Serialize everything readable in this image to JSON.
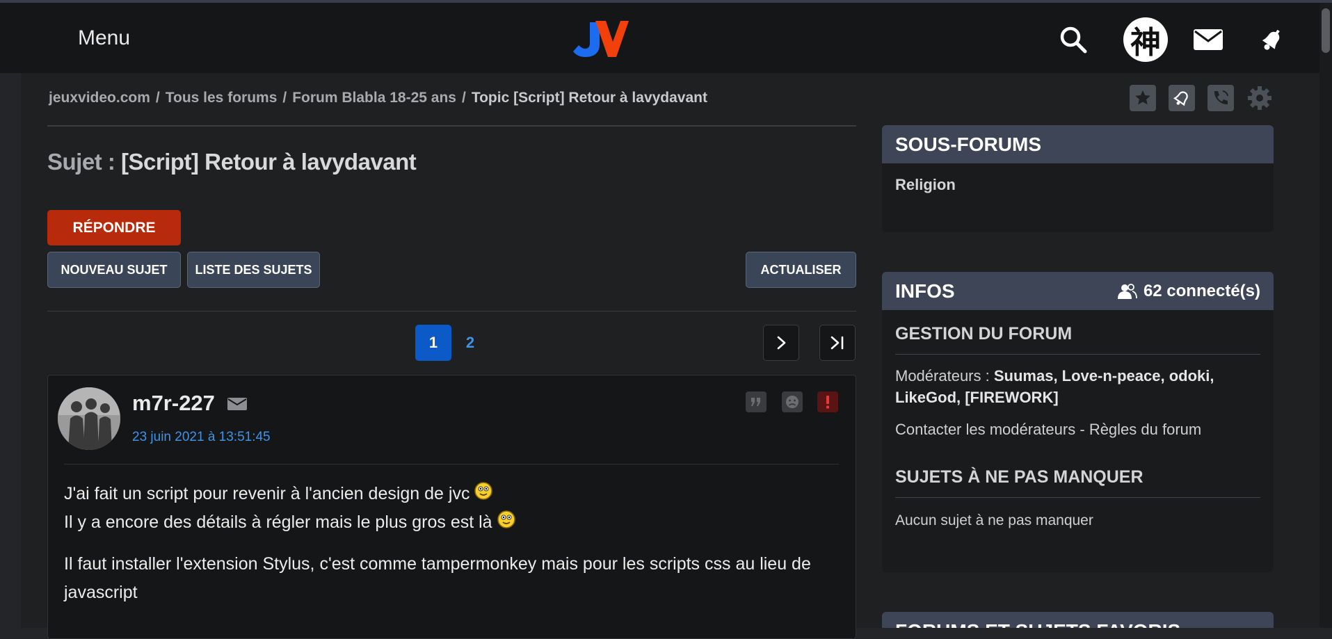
{
  "header": {
    "menu_label": "Menu",
    "logo_letters": "JV",
    "user_avatar_char": "神"
  },
  "breadcrumb": {
    "items": [
      "jeuxvideo.com",
      "Tous les forums",
      "Forum Blabla 18-25 ans"
    ],
    "current": "Topic [Script] Retour à lavydavant",
    "separator": "/"
  },
  "topic": {
    "prefix": "Sujet :",
    "title": "[Script] Retour à lavydavant"
  },
  "buttons": {
    "reply": "RÉPONDRE",
    "new_topic": "NOUVEAU SUJET",
    "topic_list": "LISTE DES SUJETS",
    "refresh": "ACTUALISER"
  },
  "pagination": {
    "pages": [
      "1",
      "2"
    ],
    "current": "1"
  },
  "post": {
    "author": "m7r-227",
    "date": "23 juin 2021 à 13:51:45",
    "body": {
      "line1": "J'ai fait un script pour revenir à l'ancien design de jvc",
      "line2": "Il y a encore des détails à régler mais le plus gros est là",
      "para2": "Il faut installer l'extension Stylus, c'est comme tampermonkey mais pour les scripts css au lieu de javascript"
    }
  },
  "sidebar": {
    "sous_forums": {
      "title": "SOUS-FORUMS",
      "items": [
        "Religion"
      ]
    },
    "infos": {
      "title": "INFOS",
      "online": "62 connecté(s)",
      "gestion_title": "GESTION DU FORUM",
      "moderators_label": "Modérateurs :",
      "moderators": "Suumas, Love-n-peace, odoki,",
      "moderators2": "LikeGod, [FIREWORK]",
      "contact": "Contacter les modérateurs",
      "dash": "-",
      "rules": "Règles du forum",
      "must_see_title": "SUJETS À NE PAS MANQUER",
      "must_see_empty": "Aucun sujet à ne pas manquer"
    },
    "favorites_title": "FORUMS ET SUJETS FAVORIS"
  },
  "colors": {
    "reply_button": "#b72b0c",
    "link_blue": "#3f93e8",
    "panel_header": "#3d4556",
    "active_page": "#0c5ac8",
    "logo_j": "#1b6cf0",
    "logo_v": "#f2400c"
  },
  "icons": {
    "header": [
      "search-icon",
      "mail-icon",
      "bell-icon"
    ],
    "toolbar": [
      "star-icon",
      "bell-icon",
      "phone-icon",
      "gear-icon"
    ],
    "post_actions": [
      "quote-icon",
      "sad-face-icon",
      "alert-icon"
    ]
  }
}
